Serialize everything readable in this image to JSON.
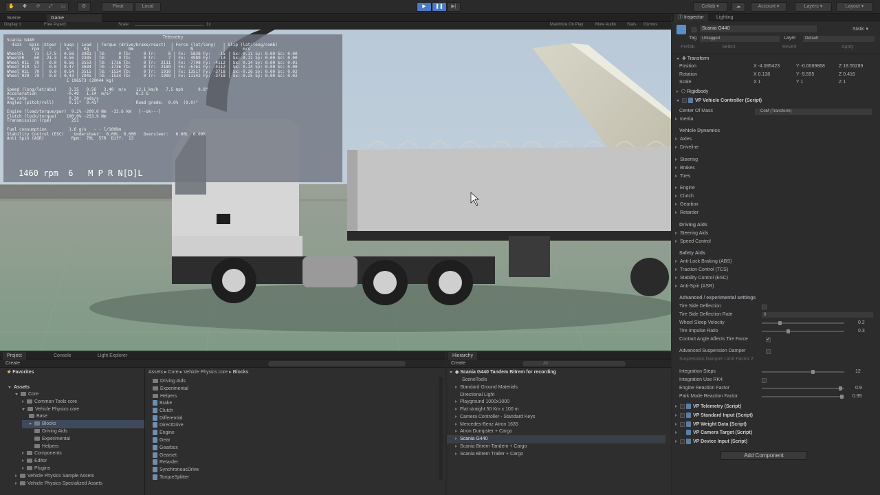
{
  "toolbar": {
    "pivot": "Pivot",
    "local": "Local",
    "collab": "Collab",
    "account": "Account",
    "layers": "Layers",
    "layout": "Layout"
  },
  "scene_tabs": {
    "scene": "Scene",
    "game": "Game"
  },
  "gamebar": {
    "display": "Display 1",
    "aspect": "Free Aspect",
    "scale": "Scale",
    "scale_val": "1x",
    "maximize": "Maximize On Play",
    "mute": "Mute Audio",
    "stats": "Stats",
    "gizmos": "Gizmos"
  },
  "telemetry": {
    "title": "Telemetry",
    "text": "Scania G440\n  4323   Spin |Steer | Susp | Load  | Torque (drive/brake/react)  | Force (lat/long)   | Slip (lat/long/comb)\n          rpm |  °   |  %   |  Kg   |            Nm               |       N            |       m/s\nWheelFL    73 | 17.5 | 0.58 | 3981 | Td:     0 Tb:     0 Tr:     8 | Fx:  5838 Fy:   -15 | Sx:-0.11 Sy: 0.00 Sc: 0.00\nWheelFR    60 | 21.3 | 0.56 | 2385 | Td:     0 Tb:     0 Tr:     7 | Fx:  4989 Fy:   -13 | Sx:-0.11 Sy: 0.00 Sc: 0.00\nWheel_01L  70 |  0.0 | 0.56 | 3553 | Td: -1736 Tb:     0 Tr:  2111 | Fx: -7708 Fy: -4112 | Sx: 0.14 Sy: 0.00 Sc: 0.01\nWheel_01R  57 |  0.0 | 0.47 | 3684 | Td: -1736 Tb:     0 Tr:  2189 | Fx: -6761 Fy: -4112 | Sx: 0.14 Sy: 0.00 Sc: 0.00\nWheel_02L  70 |  0.0 | 0.54 | 3515 | Td: -1534 Tb:     0 Tr:  1910 | Fx: 13517 Fy: -3718 | Sx:-0.26 Sy: 0.00 Sc: 0.02\nWheel_02R  70 |  0.0 | 0.43 | 2945 | Td: -1534 Tb:     0 Tr:  1909 | Fx: 11142 Fy: -3718 | Sx:-0.25 Sy: 0.00 Sc: 0.02\n                        Σ 196573 (20044 kg)\n\nSpeed (long/lat/abs)     3.35   0.56   3.40  m/s    12.1 km/h   7.5 mph      9.8°\nAcceleration            -0.49   1.14  m/s²          0.2 G\nYaw rate                 0.30  rads/s\nAngles (pitch/roll)      0.11°  0.41°               Road grade:  0.0%  (0.0)°\n\nEngine (load/torque/pwr)  9.2% -209.0 Nm  -33.6 kW   [--ok---]\nClutch (lock/torque)    100.0% -253.9 Nm\nTransmission (rpm)        251\n\nFuel consumption         1.6 g/s   - - l/100km\nStability Control (ESC)    Understeer:  0.00L  0.00R   Oversteer:   0.00L  0.00R\nAnti Spin (ASR)           Rpm:  70L  57R  Diff:  13",
    "rpm_line": "1460 rpm  6   M P R N[D]L"
  },
  "inspector": {
    "tab1": "Inspector",
    "tab2": "Lighting",
    "object_name": "Scania G440",
    "static": "Static",
    "tag_label": "Tag",
    "tag_value": "Untagged",
    "layer_label": "Layer",
    "layer_value": "Default",
    "prefab": "Prefab",
    "select": "Select",
    "revert": "Revert",
    "apply": "Apply",
    "transform": "Transform",
    "position": {
      "label": "Position",
      "x": "-4.085423",
      "y": "-0.0069868",
      "z": "18.55289"
    },
    "rotation": {
      "label": "Rotation",
      "x": "0.138",
      "y": "-5.595",
      "z": "0.416"
    },
    "scale": {
      "label": "Scale",
      "x": "1",
      "y": "1",
      "z": "1"
    },
    "rigidbody": "Rigidbody",
    "vpc": "VP Vehicle Controller (Script)",
    "center_of_mass": "Center Of Mass",
    "com_value": "CoM (Transform)",
    "inertia": "Inertia",
    "vehicle_dynamics": "Vehicle Dynamics",
    "axles": "Axles",
    "driveline": "Driveline",
    "steering": "Steering",
    "brakes": "Brakes",
    "tires": "Tires",
    "engine": "Engine",
    "clutch": "Clutch",
    "gearbox": "Gearbox",
    "retarder": "Retarder",
    "driving_aids": "Driving Aids",
    "steering_aids": "Steering Aids",
    "speed_control": "Speed Control",
    "safety_aids": "Safety Aids",
    "abs": "Anti-Lock Braking (ABS)",
    "tcs": "Traction Control (TCS)",
    "esc": "Stability Control (ESC)",
    "asr": "Anti-Spin (ASR)",
    "advanced": "Advanced / experimental settings",
    "tsd": "Tire Side Deflection",
    "tsdr": "Tire Side Deflection Rate",
    "tsdr_val": "0",
    "wsv": "Wheel Sleep Velocity",
    "wsv_val": "0.2",
    "tir": "Tire Impulse Ratio",
    "tir_val": "0.3",
    "caa": "Contact Angle Affects Tire Force",
    "asd": "Advanced Suspension Damper",
    "sdlf": "Suspension Damper Limit Factor",
    "sdlf_val": "2",
    "int_steps": "Integration Steps",
    "int_steps_val": "12",
    "int_rk4": "Integration Use RK4",
    "erf": "Engine Reaction Factor",
    "erf_val": "0.9",
    "pmrf": "Park Mode Reaction Factor",
    "pmrf_val": "0.95",
    "comp1": "VP Telemetry (Script)",
    "comp2": "VP Standard Input (Script)",
    "comp3": "VP Weight Data (Script)",
    "comp4": "VP Camera Target (Script)",
    "comp5": "VP Device Input (Script)",
    "add_component": "Add Component"
  },
  "project": {
    "tab1": "Project",
    "tab2": "Console",
    "tab3": "Light Explorer",
    "create": "Create",
    "favorites": "Favorites",
    "assets": "Assets",
    "tree": [
      "Core",
      "Common Tools core",
      "Vehicle Physics core",
      "Base",
      "Blocks",
      "Driving Aids",
      "Experimental",
      "Helpers",
      "Components",
      "Editor",
      "Plugins",
      "Vehicle Physics Sample Assets",
      "Vehicle Physics Specialized Assets"
    ],
    "breadcrumb": [
      "Assets",
      "Core",
      "Vehicle Physics core",
      "Blocks"
    ],
    "files": [
      "Driving Aids",
      "Experimental",
      "Helpers",
      "Brake",
      "Clutch",
      "Differential",
      "DirectDrive",
      "Engine",
      "Gear",
      "Gearbox",
      "Gearset",
      "Retarder",
      "SynchronousDrive",
      "TorqueSplitter"
    ]
  },
  "hierarchy": {
    "tab": "Hierarchy",
    "create": "Create",
    "all": "All",
    "scene": "Scania G440 Tandem Bitrem for recording",
    "items": [
      "SceneTools",
      "Standard Ground Materials",
      "Directional Light",
      "Playground 1000x1000",
      "Flat straight 50 Km x 100 m",
      "Camera Controller - Standard Keys",
      "Mercedes-Benz Atron 1635",
      "Atron Dumpster + Cargo",
      "Scania G440",
      "Scania Bitrem Tandem + Cargo",
      "Scania Bitrem Trailer + Cargo"
    ]
  }
}
